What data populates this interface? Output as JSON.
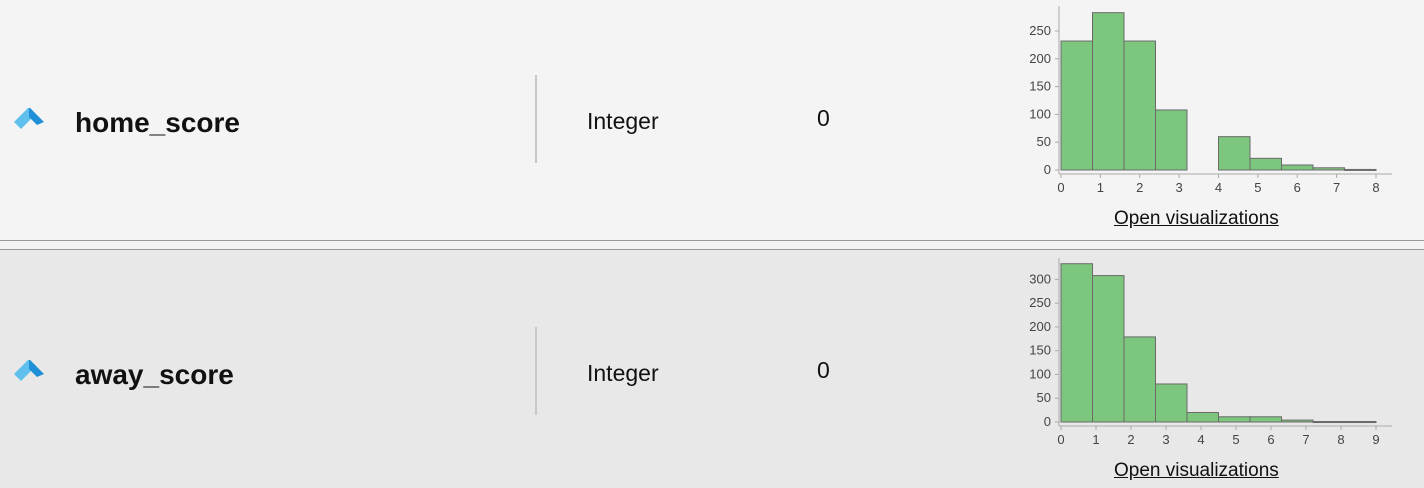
{
  "attributes": [
    {
      "name": "home_score",
      "type": "Integer",
      "missing": "0",
      "link": "Open visualizations"
    },
    {
      "name": "away_score",
      "type": "Integer",
      "missing": "0",
      "link": "Open visualizations"
    }
  ],
  "colors": {
    "bar_fill": "#7dc67d",
    "bar_stroke": "#6a6a6a",
    "icon_light": "#5fc0ee",
    "icon_dark": "#1f8fd8"
  },
  "chart_data": [
    {
      "type": "bar",
      "bins": [
        {
          "x0": 0,
          "x1": 0.8,
          "count": 232
        },
        {
          "x0": 0.8,
          "x1": 1.6,
          "count": 283
        },
        {
          "x0": 1.6,
          "x1": 2.4,
          "count": 232
        },
        {
          "x0": 2.4,
          "x1": 3.2,
          "count": 108
        },
        {
          "x0": 3.2,
          "x1": 4.0,
          "count": 0
        },
        {
          "x0": 4.0,
          "x1": 4.8,
          "count": 60
        },
        {
          "x0": 4.8,
          "x1": 5.6,
          "count": 21
        },
        {
          "x0": 5.6,
          "x1": 6.4,
          "count": 9
        },
        {
          "x0": 6.4,
          "x1": 7.2,
          "count": 4
        },
        {
          "x0": 7.2,
          "x1": 8.0,
          "count": 1
        }
      ],
      "xticks": [
        0,
        1,
        2,
        3,
        4,
        5,
        6,
        7,
        8
      ],
      "yticks": [
        0,
        50,
        100,
        150,
        200,
        250
      ],
      "xlim": [
        0,
        8
      ],
      "ylim": [
        0,
        295
      ],
      "grid": false
    },
    {
      "type": "bar",
      "bins": [
        {
          "x0": 0,
          "x1": 0.9,
          "count": 333
        },
        {
          "x0": 0.9,
          "x1": 1.8,
          "count": 308
        },
        {
          "x0": 1.8,
          "x1": 2.7,
          "count": 179
        },
        {
          "x0": 2.7,
          "x1": 3.6,
          "count": 80
        },
        {
          "x0": 3.6,
          "x1": 4.5,
          "count": 20
        },
        {
          "x0": 4.5,
          "x1": 5.4,
          "count": 11
        },
        {
          "x0": 5.4,
          "x1": 6.3,
          "count": 11
        },
        {
          "x0": 6.3,
          "x1": 7.2,
          "count": 4
        },
        {
          "x0": 7.2,
          "x1": 8.1,
          "count": 1
        },
        {
          "x0": 8.1,
          "x1": 9.0,
          "count": 1
        }
      ],
      "xticks": [
        0,
        1,
        2,
        3,
        4,
        5,
        6,
        7,
        8,
        9
      ],
      "yticks": [
        0,
        50,
        100,
        150,
        200,
        250,
        300
      ],
      "xlim": [
        0,
        9
      ],
      "ylim": [
        0,
        345
      ],
      "grid": false
    }
  ]
}
